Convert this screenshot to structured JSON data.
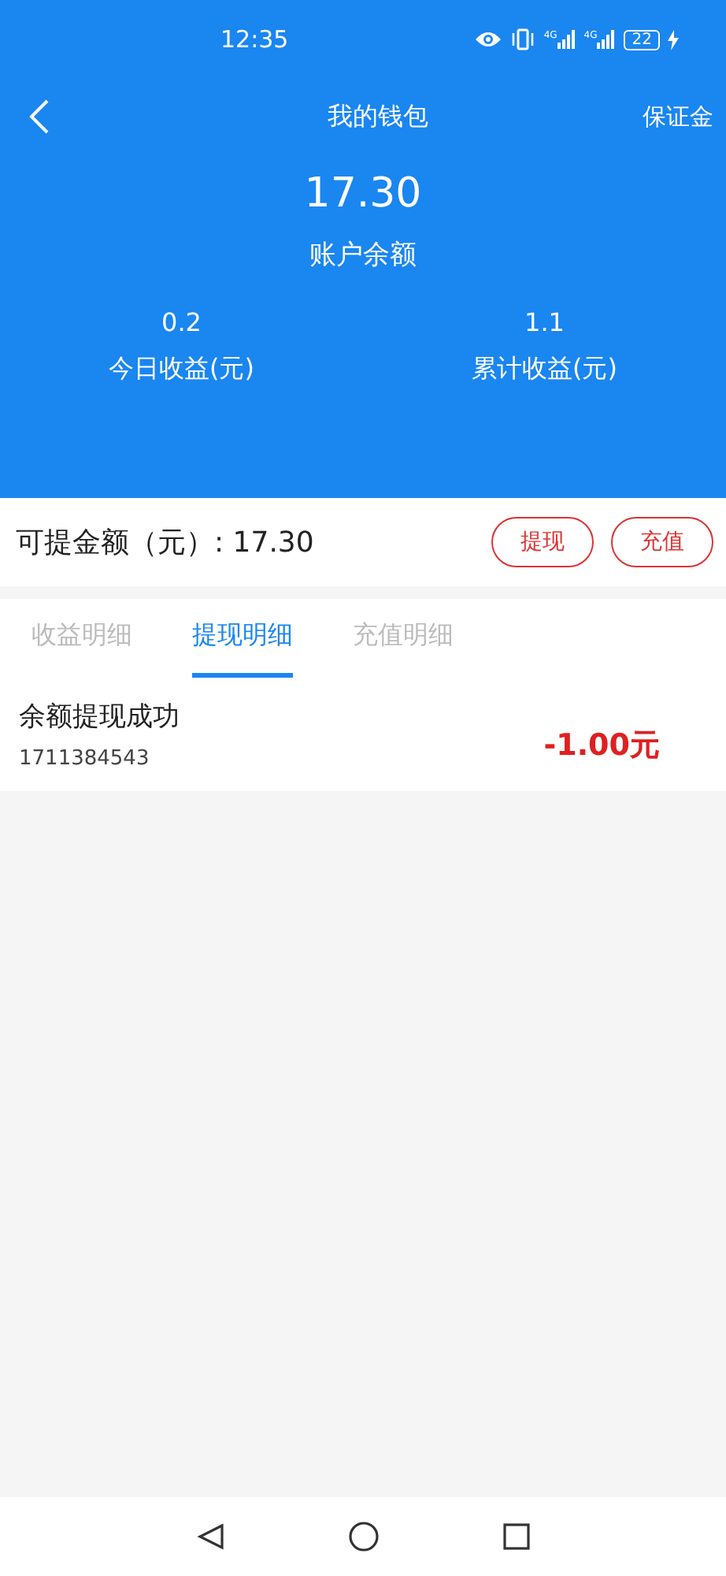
{
  "status_bar": {
    "time": "12:35",
    "network_labels": [
      "4G",
      "4G"
    ],
    "battery": "22"
  },
  "nav": {
    "title": "我的钱包",
    "action": "保证金"
  },
  "balance": {
    "amount": "17.30",
    "label": "账户余额"
  },
  "stats": [
    {
      "value": "0.2",
      "label": "今日收益(元)"
    },
    {
      "value": "1.1",
      "label": "累计收益(元)"
    }
  ],
  "withdrawable": {
    "label": "可提金额（元）:",
    "amount": "17.30",
    "buttons": [
      "提现",
      "充值"
    ]
  },
  "tabs": [
    {
      "label": "收益明细",
      "selected": false
    },
    {
      "label": "提现明细",
      "selected": true
    },
    {
      "label": "充值明细",
      "selected": false
    }
  ],
  "records": [
    {
      "title": "余额提现成功",
      "id": "1711384543",
      "amount": "-1.00元"
    }
  ]
}
